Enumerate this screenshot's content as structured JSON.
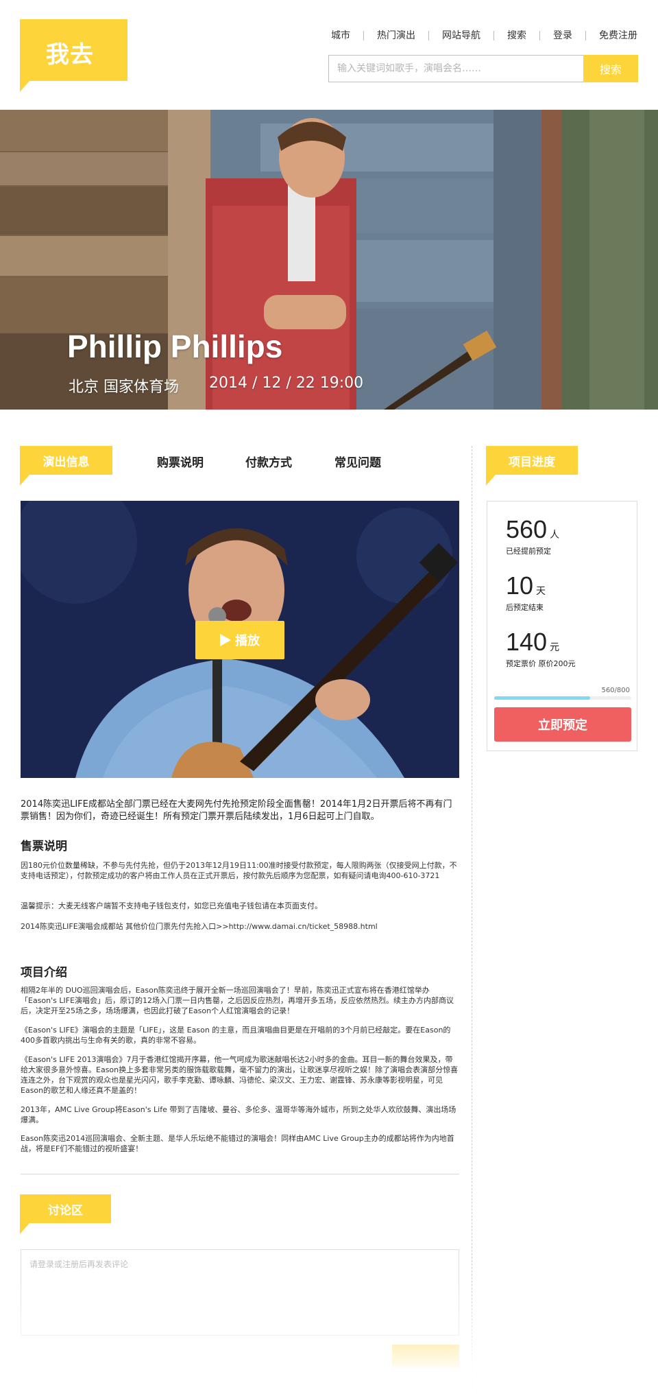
{
  "header": {
    "logo_text": "我去",
    "nav": [
      "城市",
      "热门演出",
      "网站导航",
      "搜索",
      "登录",
      "免费注册"
    ],
    "search": {
      "placeholder": "输入关键词如歌手，演唱会名……",
      "button": "搜索"
    }
  },
  "banner": {
    "artist": "Phillip Phillips",
    "venue": "北京 国家体育场",
    "datetime": "2014 / 12 / 22  19:00"
  },
  "tabs": {
    "active": "演出信息",
    "items": [
      "购票说明",
      "付款方式",
      "常见问题"
    ]
  },
  "video": {
    "play_label": "播放"
  },
  "content": {
    "intro": "2014陈奕迅LIFE成都站全部门票已经在大麦网先付先抢预定阶段全面售罄！2014年1月2日开票后将不再有门票销售！因为你们，奇迹已经诞生！所有预定门票开票后陆续发出，1月6日起可上门自取。",
    "ticket_heading": "售票说明",
    "ticket_paras": [
      "因180元价位数量稀缺，不参与先付先抢，但仍于2013年12月19日11:00准时接受付款预定，每人限购两张（仅接受网上付款，不支持电话预定），付款预定成功的客户将由工作人员在正式开票后，按付款先后顺序为您配票，如有疑问请电询400-610-3721",
      "温馨提示：大麦无线客户端暂不支持电子钱包支付，如您已充值电子钱包请在本页面支付。",
      "2014陈奕迅LIFE演唱会成都站 其他价位门票先付先抢入口>>http://www.damai.cn/ticket_58988.html"
    ],
    "project_heading": "项目介绍",
    "project_paras": [
      "相隔2年半的 DUO巡回演唱会后，Eason陈奕迅终于展开全新一场巡回演唱会了！早前，陈奕迅正式宣布将在香港红馆举办「Eason's LIFE演唱会」后，原订的12场入门票一日内售罄，之后因反应热烈，再增开多五场，反应依然热烈。续主办方内部商议后，决定开至25场之多，场场爆满，也因此打破了Eason个人红馆演唱会的记录！",
      "《Eason's LIFE》演唱会的主题是「LIFE」，这是 Eason 的主意，而且演唱曲目更是在开唱前的3个月前已经敲定。要在Eason的400多首歌内挑出与生命有关的歌，真的非常不容易。",
      "《Eason's LIFE 2013演唱会》7月于香港红馆揭开序幕，他一气呵成为歌迷献唱长达2小时多的金曲。耳目一新的舞台效果及，带给大家很多意外惊喜。Eason换上多套非常另类的服饰载歌载舞，毫不留力的演出，让歌迷享尽视听之娱！除了演唱会表演部分惊喜连连之外，台下观赏的观众也是星光闪闪，歌手李克勤、谭咏麟、冯德伦、梁汉文、王力宏、谢霆锋、苏永康等影视明星，可见Eason的歌艺和人缘还真不是盖的！",
      "2013年，AMC Live Group将Eason's Life 带到了吉隆坡、曼谷、多伦多、温哥华等海外城市，所到之处华人欢欣鼓舞、演出场场爆满。",
      "Eason陈奕迅2014巡回演唱会、全新主题、是华人乐坛绝不能错过的演唱会！同样由AMC Live Group主办的成都站将作为内地首战，将是EF们不能错过的视听盛宴！"
    ]
  },
  "discussion": {
    "title": "讨论区",
    "placeholder": "请登录或注册后再发表评论"
  },
  "sidebar": {
    "title": "项目进度",
    "stats": [
      {
        "value": "560",
        "unit": "人",
        "label": "已经提前预定"
      },
      {
        "value": "10",
        "unit": "天",
        "label": "后预定结束"
      },
      {
        "value": "140",
        "unit": "元",
        "label": "预定票价 原价200元"
      }
    ],
    "progress": {
      "text": "560/800",
      "current": 560,
      "total": 800
    },
    "reserve_button": "立即预定"
  },
  "colors": {
    "accent": "#fdd53b",
    "reserve": "#f06060",
    "progress": "#7fdcf0"
  }
}
